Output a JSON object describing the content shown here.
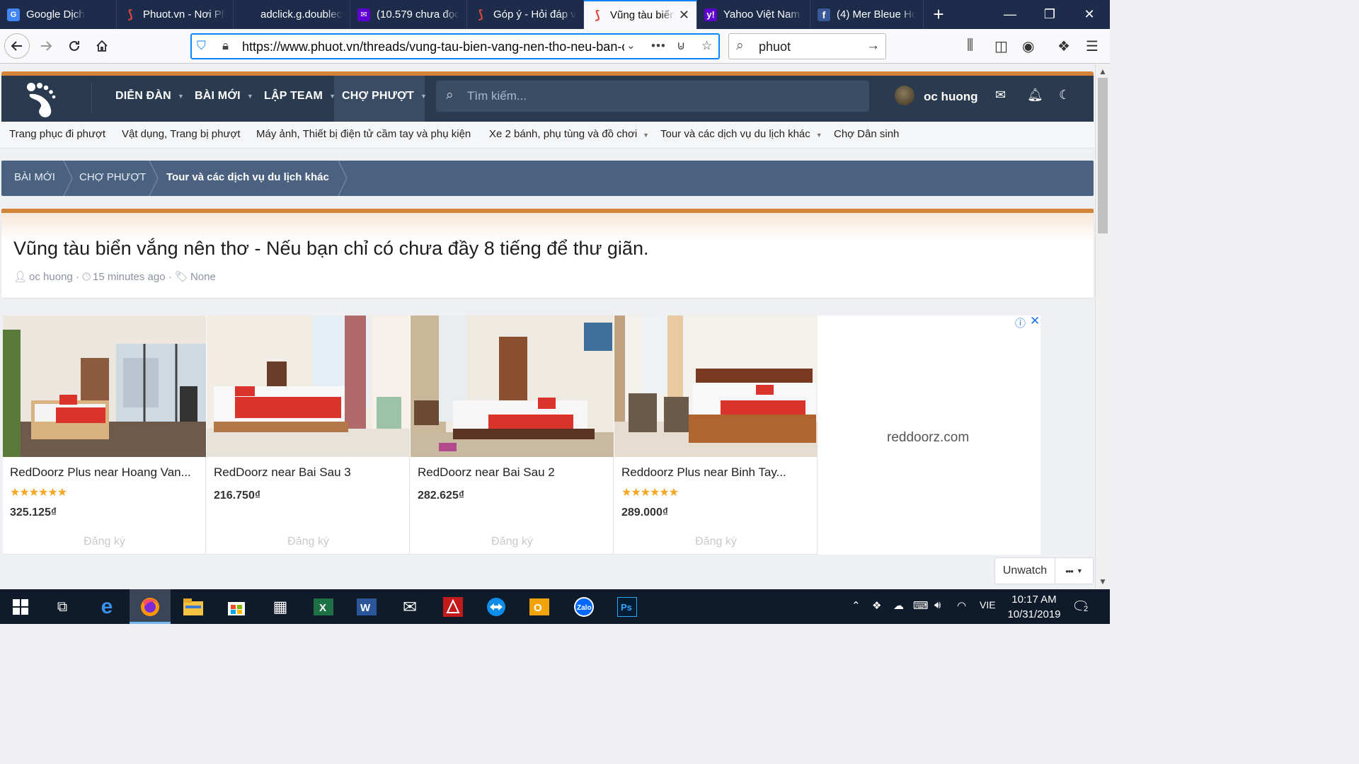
{
  "browser": {
    "tabs": [
      {
        "title": "Google Dịch",
        "icon": "google-translate-icon",
        "active": false
      },
      {
        "title": "Phuot.vn - Nơi Ph",
        "icon": "phuot-favicon",
        "active": false
      },
      {
        "title": "adclick.g.doubleclick",
        "icon": "blank-page-icon",
        "active": false
      },
      {
        "title": "(10.579 chưa đọc",
        "icon": "yahoo-mail-icon",
        "active": false
      },
      {
        "title": "Góp ý - Hỏi đáp v",
        "icon": "phuot-favicon",
        "active": false
      },
      {
        "title": "Vũng tàu biển",
        "icon": "phuot-favicon",
        "active": true
      },
      {
        "title": "Yahoo Việt Nam |",
        "icon": "yahoo-icon",
        "active": false
      },
      {
        "title": "(4) Mer Bleue Ho",
        "icon": "facebook-icon",
        "active": false
      }
    ],
    "url": "https://www.phuot.vn/threads/vung-tau-bien-vang-nen-tho-neu-ban-cl",
    "search_value": "phuot"
  },
  "site": {
    "nav": [
      "DIỄN ĐÀN",
      "BÀI MỚI",
      "LẬP TEAM",
      "CHỢ PHƯỢT"
    ],
    "search_placeholder": "Tìm kiếm...",
    "username": "oc huong",
    "subnav": [
      "Trang phục đi phượt",
      "Vật dụng, Trang bị phượt",
      "Máy ảnh, Thiết bị điện tử cầm tay và phụ kiện",
      "Xe 2 bánh, phụ tùng và đồ chơi",
      "Tour và các dịch vụ du lịch khác",
      "Chợ Dân sinh"
    ],
    "breadcrumb": [
      "BÀI MỚI",
      "CHỢ PHƯỢT",
      "Tour và các dịch vụ du lịch khác"
    ]
  },
  "thread": {
    "title": "Vũng tàu biển vắng nên thơ - Nếu bạn chỉ có chưa đầy 8 tiếng để thư giãn.",
    "author": "oc huong",
    "time": "15 minutes ago",
    "tags": "None"
  },
  "ad": {
    "domain": "reddoorz.com",
    "cards": [
      {
        "name": "RedDoorz Plus near Hoang Van...",
        "stars": "★★★★★★",
        "price": "325.125₫",
        "cta": "Đăng ký"
      },
      {
        "name": "RedDoorz near Bai Sau 3",
        "stars": "",
        "price": "216.750₫",
        "cta": "Đăng ký"
      },
      {
        "name": "RedDoorz near Bai Sau 2",
        "stars": "",
        "price": "282.625₫",
        "cta": "Đăng ký"
      },
      {
        "name": "Reddoorz Plus near Binh Tay...",
        "stars": "★★★★★★",
        "price": "289.000₫",
        "cta": "Đăng ký"
      }
    ]
  },
  "actions": {
    "unwatch": "Unwatch",
    "more": "•••"
  },
  "taskbar": {
    "lang": "VIE",
    "time": "10:17 AM",
    "date": "10/31/2019",
    "notifications": "2"
  }
}
